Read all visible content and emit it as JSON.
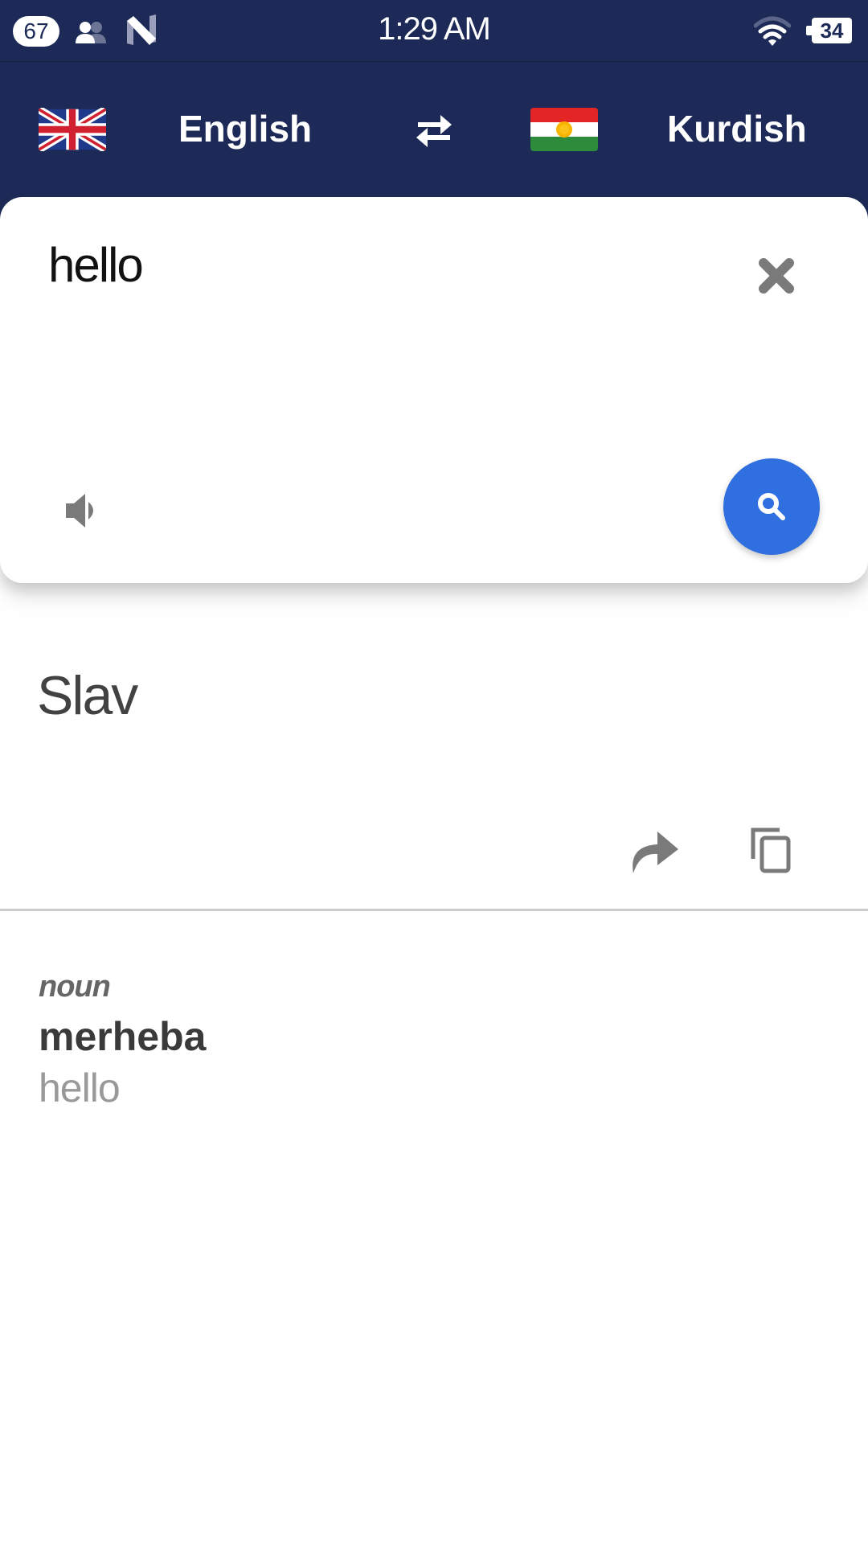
{
  "status_bar": {
    "notification_count": "67",
    "icons": [
      "people-icon",
      "n-logo-icon"
    ],
    "time": "1:29 AM",
    "wifi_icon": "wifi-icon",
    "battery_level": "34"
  },
  "header": {
    "source_language": {
      "label": "English",
      "flag": "uk-flag-icon"
    },
    "swap_icon": "swap-arrows-icon",
    "target_language": {
      "label": "Kurdish",
      "flag": "kurdistan-flag-icon"
    }
  },
  "input_card": {
    "input_text": "hello",
    "clear_icon": "close-icon",
    "speak_icon": "speaker-icon",
    "translate_icon": "search-icon"
  },
  "result": {
    "translation": "Slav",
    "share_icon": "share-icon",
    "copy_icon": "copy-icon"
  },
  "dictionary": {
    "entries": [
      {
        "part_of_speech": "noun",
        "word": "merheba",
        "gloss": "hello"
      }
    ]
  },
  "colors": {
    "header_bg": "#1d2a57",
    "fab": "#2f6fdf",
    "icon_gray": "#7a7a7a"
  }
}
